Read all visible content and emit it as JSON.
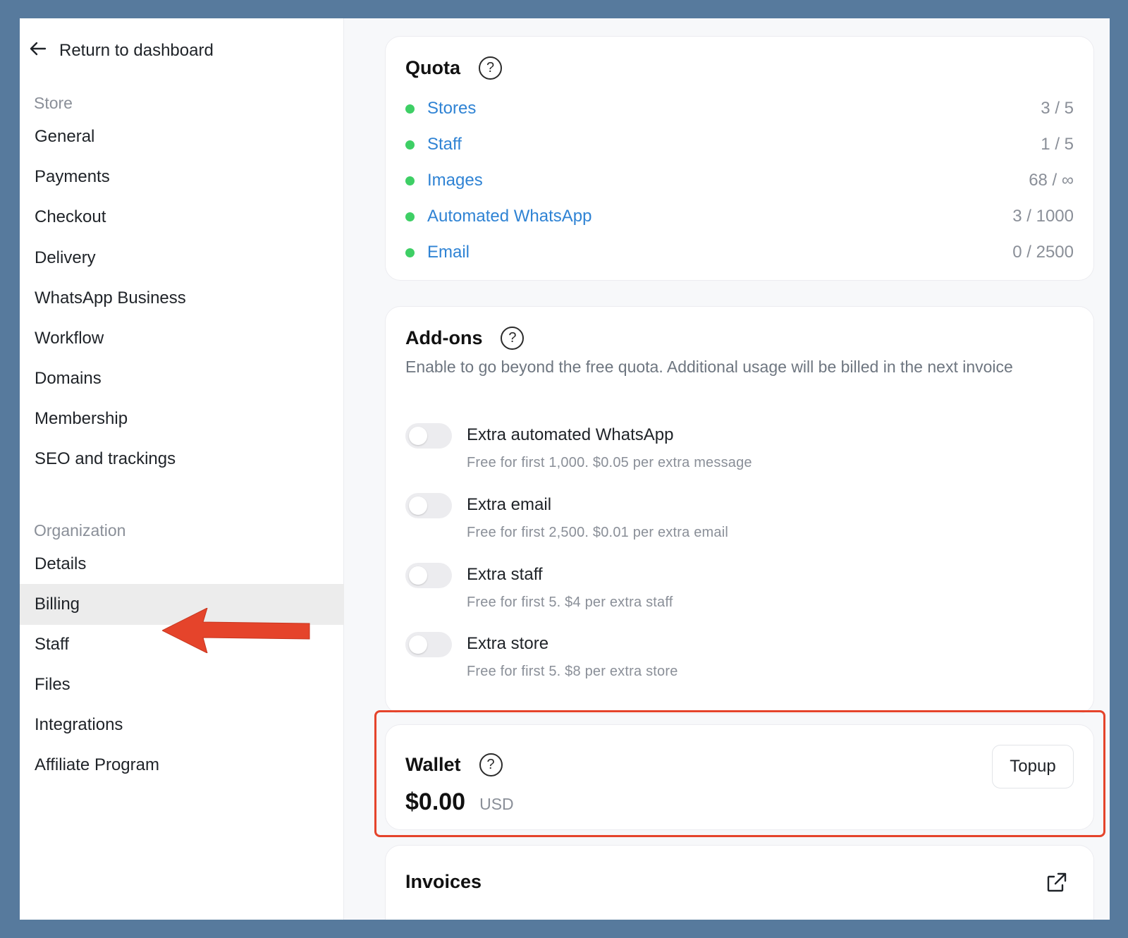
{
  "sidebar": {
    "back_label": "Return to dashboard",
    "store_group": "Store",
    "store_items": [
      "General",
      "Payments",
      "Checkout",
      "Delivery",
      "WhatsApp Business",
      "Workflow",
      "Domains",
      "Membership",
      "SEO and trackings"
    ],
    "org_group": "Organization",
    "org_items": [
      "Details",
      "Billing",
      "Staff",
      "Files",
      "Integrations",
      "Affiliate Program"
    ],
    "active_item": "Billing"
  },
  "quota": {
    "title": "Quota",
    "rows": [
      {
        "name": "Stores",
        "value": "3 / 5"
      },
      {
        "name": "Staff",
        "value": "1 / 5"
      },
      {
        "name": "Images",
        "value": "68 / ∞"
      },
      {
        "name": "Automated WhatsApp",
        "value": "3 / 1000"
      },
      {
        "name": "Email",
        "value": "0 / 2500"
      }
    ]
  },
  "addons": {
    "title": "Add-ons",
    "description": "Enable to go beyond the free quota. Additional usage will be billed in the next invoice",
    "items": [
      {
        "title": "Extra automated WhatsApp",
        "subtitle": "Free for first 1,000. $0.05 per extra message",
        "enabled": false
      },
      {
        "title": "Extra email",
        "subtitle": "Free for first 2,500. $0.01 per extra email",
        "enabled": false
      },
      {
        "title": "Extra staff",
        "subtitle": "Free for first 5. $4 per extra staff",
        "enabled": false
      },
      {
        "title": "Extra store",
        "subtitle": "Free for first 5. $8 per extra store",
        "enabled": false
      }
    ]
  },
  "wallet": {
    "title": "Wallet",
    "amount": "$0.00",
    "currency": "USD",
    "topup_label": "Topup"
  },
  "invoices": {
    "title": "Invoices"
  },
  "colors": {
    "accent_link": "#2f83d4",
    "status_dot": "#3ecf65",
    "highlight": "#e5442b",
    "background": "#577a9d"
  },
  "icons": {
    "back": "arrow-left-icon",
    "help": "question-circle-icon",
    "external": "external-link-icon",
    "annotation": "red-arrow"
  }
}
